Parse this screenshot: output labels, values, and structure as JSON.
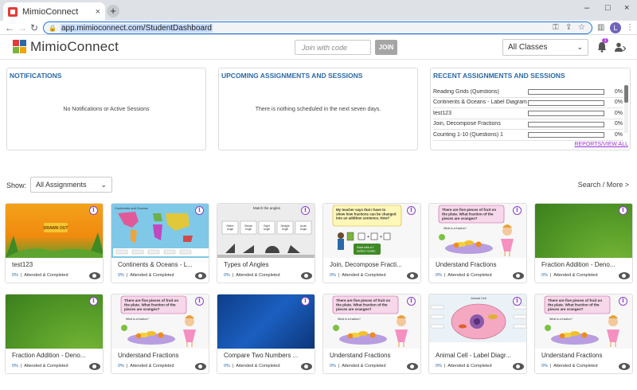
{
  "browser": {
    "tab_title": "MimioConnect",
    "tab_close": "×",
    "new_tab": "+",
    "url": "app.mimioconnect.com/StudentDashboard",
    "profile_initial": "L",
    "win_minimize": "–",
    "win_maximize": "□",
    "win_close": "×"
  },
  "header": {
    "logo_text": "MimioConnect",
    "logo_colors": [
      "#e23b3b",
      "#2a6aa8",
      "#7ab33e",
      "#f0a30a"
    ],
    "join_placeholder": "Join with code",
    "join_button": "JOIN",
    "class_select": "All Classes",
    "notification_count": "1"
  },
  "panels": {
    "notifications": {
      "title": "NOTIFICATIONS",
      "message": "No Notifications or Active Sessions"
    },
    "upcoming": {
      "title": "UPCOMING ASSIGNMENTS AND SESSIONS",
      "message": "There is nothing scheduled in the next seven days."
    },
    "recent": {
      "title": "RECENT ASSIGNMENTS AND SESSIONS",
      "items": [
        {
          "name": "Reading Grids (Questions)",
          "progress": 0,
          "pct": "0%"
        },
        {
          "name": "Continents & Oceans - Label Diagram",
          "progress": 0,
          "pct": "0%"
        },
        {
          "name": "test123",
          "progress": 0,
          "pct": "0%"
        },
        {
          "name": "Join, Decompose Fractions",
          "progress": 0,
          "pct": "0%"
        },
        {
          "name": "Counting 1-10 (Questions) 1",
          "progress": 0,
          "pct": "0%"
        }
      ],
      "link": "REPORTS/VIEW ALL"
    }
  },
  "filter": {
    "show_label": "Show:",
    "show_value": "All Assignments",
    "search_more": "Search / More >"
  },
  "cards": [
    {
      "title": "test123",
      "pct": "0%",
      "status": "Attended & Completed",
      "thumb": "jungle",
      "thumb_text": "DRAWN OUT"
    },
    {
      "title": "Continents & Oceans - L...",
      "pct": "0%",
      "status": "Attended & Completed",
      "thumb": "map",
      "thumb_text": "Continents and Oceans"
    },
    {
      "title": "Types of Angles",
      "pct": "0%",
      "status": "Attended & Completed",
      "thumb": "angles",
      "thumb_text": "Match the angles"
    },
    {
      "title": "Join, Decompose Fracti...",
      "pct": "0%",
      "status": "Attended & Completed",
      "thumb": "join",
      "thumb_text": "My teacher says that I have to show how fractions can be changed into an addition sentence. How?"
    },
    {
      "title": "Understand Fractions",
      "pct": "0%",
      "status": "Attended & Completed",
      "thumb": "fruit",
      "thumb_text": "There are five pieces of fruit on the plate. What fraction of the pieces are oranges?"
    },
    {
      "title": "Fraction Addition - Deno...",
      "pct": "0%",
      "status": "Attended & Completed",
      "thumb": "green",
      "thumb_text": ""
    },
    {
      "title": "Fraction Addition - Deno...",
      "pct": "0%",
      "status": "Attended & Completed",
      "thumb": "green",
      "thumb_text": ""
    },
    {
      "title": "Understand Fractions",
      "pct": "0%",
      "status": "Attended & Completed",
      "thumb": "fruit",
      "thumb_text": "There are five pieces of fruit on the plate. What fraction of the pieces are oranges?"
    },
    {
      "title": "Compare Two Numbers ...",
      "pct": "0%",
      "status": "Attended & Completed",
      "thumb": "blue",
      "thumb_text": ""
    },
    {
      "title": "Understand Fractions",
      "pct": "0%",
      "status": "Attended & Completed",
      "thumb": "fruit",
      "thumb_text": "There are five pieces of fruit on the plate. What fraction of the pieces are oranges?"
    },
    {
      "title": "Animal Cell - Label Diagr...",
      "pct": "0%",
      "status": "Attended & Completed",
      "thumb": "cell",
      "thumb_text": "Animal Cell"
    },
    {
      "title": "Understand Fractions",
      "pct": "0%",
      "status": "Attended & Completed",
      "thumb": "fruit",
      "thumb_text": "There are five pieces of fruit on the plate. What fraction of the pieces are oranges?"
    }
  ],
  "card_labels": {
    "what_is_fraction": "What is a fraction?",
    "fraction_model": "Start with a fraction model.",
    "angle_labels": [
      "Obtuse Angle",
      "Right Angle",
      "Straight Angle",
      "Acute Angle"
    ],
    "angle_first": "Reflex Angle"
  }
}
